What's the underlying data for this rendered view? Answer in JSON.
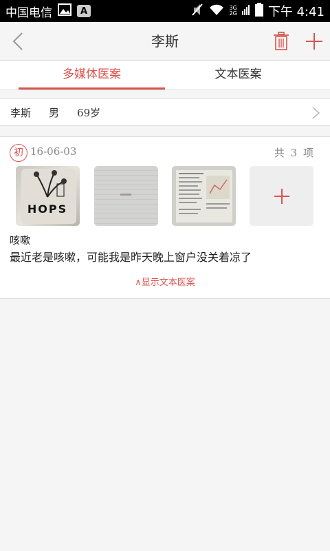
{
  "status_bar": {
    "carrier": "中国电信",
    "network_top": "3G",
    "network_bottom": "2G",
    "time": "下午 4:41",
    "keyboard_badge": "A"
  },
  "navbar": {
    "title": "李斯"
  },
  "tabs": [
    {
      "label": "多媒体医案",
      "active": true
    },
    {
      "label": "文本医案",
      "active": false
    }
  ],
  "patient": {
    "name": "李斯",
    "gender": "男",
    "age": "69岁"
  },
  "case": {
    "visit_badge": "初",
    "date": "16-06-03",
    "count_label": "共 3 项",
    "thumbnail_label": "HOPS",
    "title": "咳嗽",
    "description": "最近老是咳嗽，可能我是昨天晚上窗户没关着凉了",
    "toggle_label": "∧显示文本医案"
  },
  "colors": {
    "accent": "#d9534f",
    "background": "#f5f5f5"
  }
}
